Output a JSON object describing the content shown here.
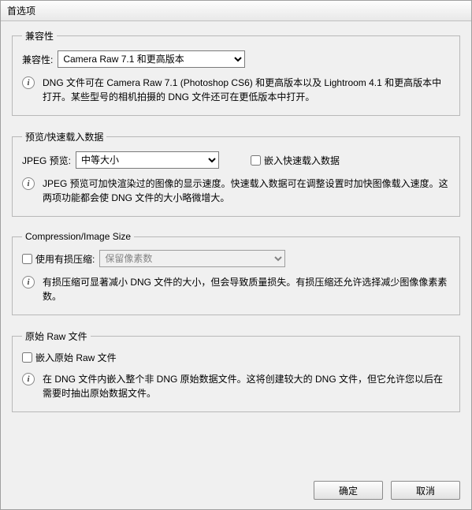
{
  "window": {
    "title": "首选项"
  },
  "compat": {
    "legend": "兼容性",
    "label": "兼容性:",
    "value": "Camera Raw 7.1 和更高版本",
    "info": "DNG 文件可在 Camera Raw 7.1 (Photoshop CS6) 和更高版本以及 Lightroom 4.1 和更高版本中打开。某些型号的相机拍摄的 DNG 文件还可在更低版本中打开。"
  },
  "preview": {
    "legend": "预览/快速载入数据",
    "jpeg_label": "JPEG 预览:",
    "jpeg_value": "中等大小",
    "embed_label": "嵌入快速载入数据",
    "info": "JPEG 预览可加快渲染过的图像的显示速度。快速载入数据可在调整设置时加快图像载入速度。这两项功能都会使 DNG 文件的大小略微增大。"
  },
  "compression": {
    "legend": "Compression/Image Size",
    "lossy_label": "使用有损压缩:",
    "lossy_value": "保留像素数",
    "info": "有损压缩可显著减小 DNG 文件的大小，但会导致质量损失。有损压缩还允许选择减少图像像素素数。"
  },
  "raw": {
    "legend": "原始 Raw 文件",
    "embed_label": "嵌入原始 Raw 文件",
    "info": "在 DNG 文件内嵌入整个非 DNG 原始数据文件。这将创建较大的 DNG 文件，但它允许您以后在需要时抽出原始数据文件。"
  },
  "buttons": {
    "ok": "确定",
    "cancel": "取消"
  }
}
